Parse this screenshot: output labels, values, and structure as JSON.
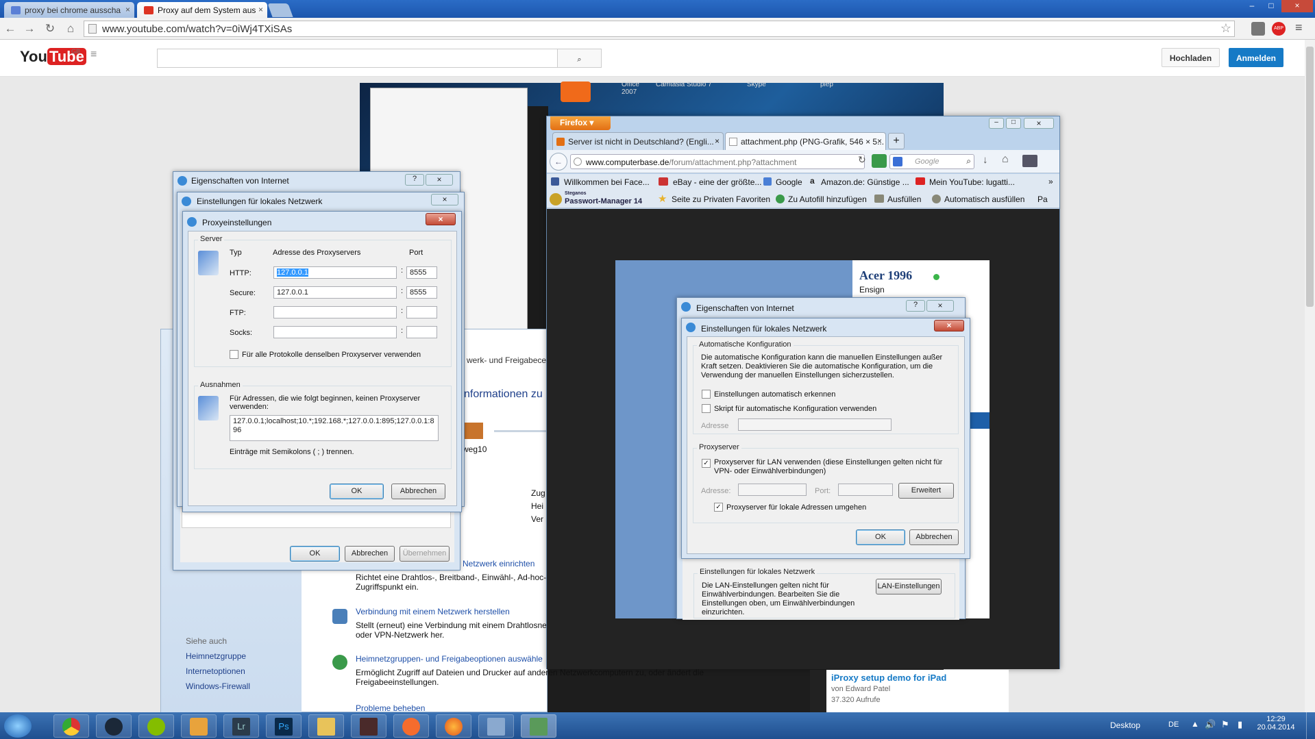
{
  "browser": {
    "tabs": [
      {
        "title": "proxy bei chrome ausscha",
        "close": "×"
      },
      {
        "title": "Proxy auf dem System aus",
        "close": "×"
      }
    ],
    "url": "www.youtube.com/watch?v=0iWj4TXiSAs",
    "window_buttons": [
      "–",
      "□",
      "×"
    ]
  },
  "youtube": {
    "logo": "YouTube",
    "region": "GB",
    "menu_icon": "≡",
    "search_placeholder": "",
    "search_icon": "🔍",
    "upload_label": "Hochladen",
    "signin_label": "Anmelden",
    "recommended": {
      "title": "iProxy setup demo for iPad",
      "author": "von Edward Patel",
      "views": "37.320 Aufrufe"
    }
  },
  "desktop_labels": {
    "office": "Office\n2007",
    "camtasia": "Camtasia Studio 7",
    "skype": "Skype",
    "plep": "plep"
  },
  "internet_props_left": {
    "title": "Eigenschaften von Internet",
    "help": "?",
    "close": "×",
    "ok": "OK",
    "cancel": "Abbrechen",
    "apply": "Übernehmen"
  },
  "lan_left": {
    "title": "Einstellungen für lokales Netzwerk",
    "close": "×"
  },
  "proxy_dialog": {
    "title": "Proxyeinstellungen",
    "close": "×",
    "server_group": "Server",
    "col_type": "Typ",
    "col_address": "Adresse des Proxyservers",
    "col_port": "Port",
    "rows": [
      {
        "type": "HTTP:",
        "address": "127.0.0.1",
        "port": "8555"
      },
      {
        "type": "Secure:",
        "address": "127.0.0.1",
        "port": "8555"
      },
      {
        "type": "FTP:",
        "address": "",
        "port": ""
      },
      {
        "type": "Socks:",
        "address": "",
        "port": ""
      }
    ],
    "colon": ":",
    "same_proxy_label": "Für alle Protokolle denselben Proxyserver verwenden",
    "exceptions_group": "Ausnahmen",
    "exceptions_desc": "Für Adressen, die wie folgt beginnen, keinen Proxyserver verwenden:",
    "exceptions_value": "127.0.0.1;localhost;10.*;192.168.*;127.0.0.1:895;127.0.0.1:896",
    "exceptions_hint": "Einträge mit Semikolons ( ; ) trennen.",
    "ok": "OK",
    "cancel": "Abbrechen"
  },
  "network_center": {
    "fragment_title": "werk- und Freigabece",
    "fragment_info": "nformationen zu",
    "node_label": "weg10",
    "side_fragments": [
      "Zug",
      "Hei",
      "Ver"
    ],
    "see_also": "Siehe auch",
    "links": [
      "Heimnetzgruppe",
      "Internetoptionen",
      "Windows-Firewall"
    ],
    "tasks": [
      {
        "title": "Netzwerk einrichten",
        "desc": "Richtet eine Drahtlos-, Breitband-, Einwähl-, Ad-hoc-\nZugriffspunkt ein."
      },
      {
        "title": "Verbindung mit einem Netzwerk herstellen",
        "desc": "Stellt (erneut) eine Verbindung mit einem Drahtlosne\noder VPN-Netzwerk her."
      },
      {
        "title": "Heimnetzgruppen- und Freigabeoptionen auswähle",
        "desc": "Ermöglicht Zugriff auf Dateien und Drucker auf anderen Netzwerkcomputern zu, oder ändert die\nFreigabeeinstellungen."
      },
      {
        "title": "Probleme beheben",
        "desc": ""
      }
    ]
  },
  "firefox": {
    "menu_button": "Firefox ▾",
    "tabs": [
      {
        "title": "Server ist nicht in Deutschland? (Engli...",
        "close": "×"
      },
      {
        "title": "attachment.php (PNG-Grafik, 546 × 5...",
        "close": "×"
      }
    ],
    "new_tab": "+",
    "url_domain": "www.computerbase.de",
    "url_path": "/forum/attachment.php?attachment",
    "search_placeholder": "Google",
    "bookmarks": [
      "Willkommen bei Face...",
      "eBay - eine der größte...",
      "Google",
      "Amazon.de: Günstige ...",
      "Mein YouTube: lugatti...",
      "»"
    ],
    "toolbar2": [
      "Passwort-Manager 14",
      "Seite zu Privaten Favoriten",
      "Zu Autofill hinzufügen",
      "Ausfüllen",
      "Automatisch ausfüllen",
      "Pa"
    ],
    "steganos": "Steganos",
    "profile_name": "Acer 1996",
    "profile_rank": "Ensign"
  },
  "internet_props_inner": {
    "title": "Eigenschaften von Internet",
    "help": "?",
    "close": "×",
    "lan_group": "Einstellungen für lokales Netzwerk",
    "lan_desc": "Die LAN-Einstellungen gelten nicht für Einwählverbindungen. Bearbeiten Sie die Einstellungen oben, um Einwählverbindungen einzurichten.",
    "lan_button": "LAN-Einstellungen"
  },
  "lan_inner": {
    "title": "Einstellungen für lokales Netzwerk",
    "close": "×",
    "auto_group": "Automatische Konfiguration",
    "auto_desc": "Die automatische Konfiguration kann die manuellen Einstellungen außer Kraft setzen. Deaktivieren Sie die automatische Konfiguration, um die Verwendung der manuellen Einstellungen sicherzustellen.",
    "auto_detect": "Einstellungen automatisch erkennen",
    "auto_script": "Skript für automatische Konfiguration verwenden",
    "address_label": "Adresse",
    "proxy_group": "Proxyserver",
    "use_proxy": "Proxyserver für LAN verwenden (diese Einstellungen gelten nicht für VPN- oder Einwählverbindungen)",
    "addr2_label": "Adresse:",
    "port_label": "Port:",
    "advanced": "Erweitert",
    "bypass_local": "Proxyserver für lokale Adressen umgehen",
    "ok": "OK",
    "cancel": "Abbrechen"
  },
  "taskbar": {
    "desktop_label": "Desktop",
    "lang": "DE",
    "time": "12:29",
    "date": "20.04.2014",
    "apps": [
      "chrome",
      "steam",
      "spotify",
      "paint",
      "Lr",
      "Ps",
      "explorer",
      "game",
      "origin",
      "firefox",
      "remote",
      "network"
    ]
  }
}
